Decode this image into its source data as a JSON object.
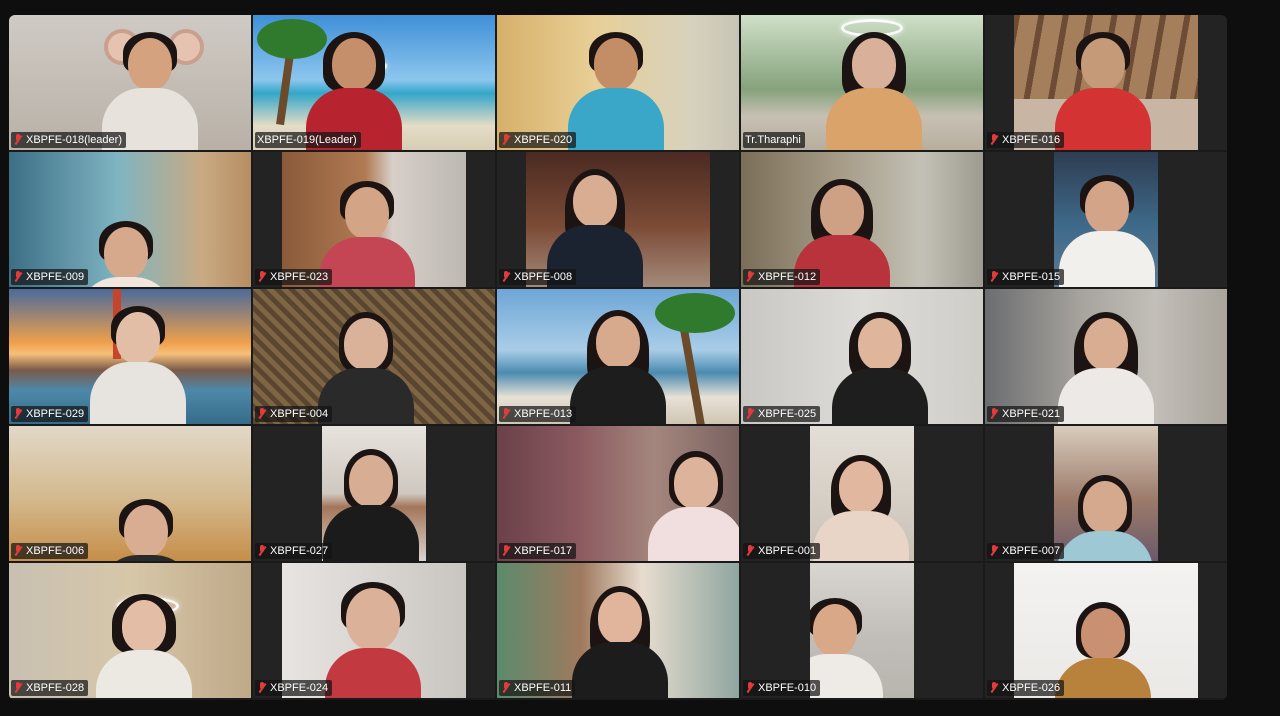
{
  "participants": [
    {
      "name": "XBPFE-018(leader)",
      "muted": true
    },
    {
      "name": "XBPFE-019(Leader)",
      "muted": false,
      "active_speaker": true
    },
    {
      "name": "XBPFE-020",
      "muted": true
    },
    {
      "name": "Tr.Tharaphi",
      "muted": false
    },
    {
      "name": "XBPFE-016",
      "muted": true
    },
    {
      "name": "XBPFE-009",
      "muted": true
    },
    {
      "name": "XBPFE-023",
      "muted": true
    },
    {
      "name": "XBPFE-008",
      "muted": true
    },
    {
      "name": "XBPFE-012",
      "muted": true
    },
    {
      "name": "XBPFE-015",
      "muted": true
    },
    {
      "name": "XBPFE-029",
      "muted": true
    },
    {
      "name": "XBPFE-004",
      "muted": true
    },
    {
      "name": "XBPFE-013",
      "muted": true
    },
    {
      "name": "XBPFE-025",
      "muted": true
    },
    {
      "name": "XBPFE-021",
      "muted": true
    },
    {
      "name": "XBPFE-006",
      "muted": true
    },
    {
      "name": "XBPFE-027",
      "muted": true
    },
    {
      "name": "XBPFE-017",
      "muted": true
    },
    {
      "name": "XBPFE-001",
      "muted": true
    },
    {
      "name": "XBPFE-007",
      "muted": true
    },
    {
      "name": "XBPFE-028",
      "muted": true
    },
    {
      "name": "XBPFE-024",
      "muted": true
    },
    {
      "name": "XBPFE-011",
      "muted": true
    },
    {
      "name": "XBPFE-010",
      "muted": true
    },
    {
      "name": "XBPFE-026",
      "muted": true
    }
  ],
  "colors": {
    "background": "#0e0e0e",
    "tile": "#232323",
    "active_border": "#2ecc71",
    "muted_icon": "#e23b3b"
  },
  "icons": {
    "muted": "microphone-muted-icon"
  }
}
